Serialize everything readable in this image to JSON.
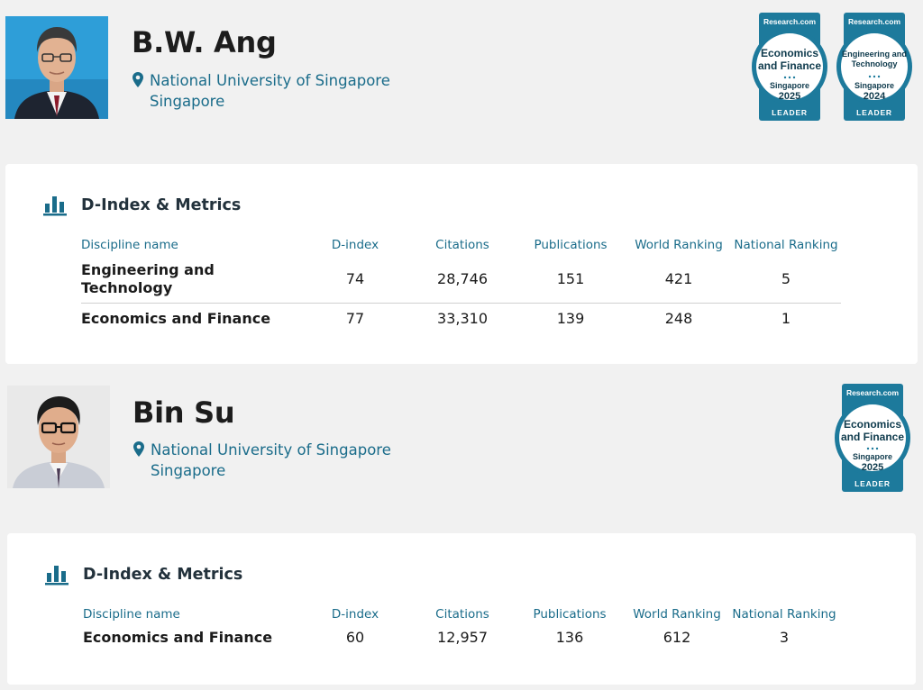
{
  "profiles": [
    {
      "name": "B.W. Ang",
      "university": "National University of Singapore",
      "country": "Singapore",
      "badges": [
        {
          "site": "Research.com",
          "line1": "Economics",
          "line2": "and Finance",
          "region": "Singapore",
          "year": "2025",
          "tag": "LEADER"
        },
        {
          "site": "Research.com",
          "line1": "Engineering and",
          "line2": "Technology",
          "region": "Singapore",
          "year": "2024",
          "tag": "LEADER"
        }
      ],
      "metrics": {
        "title": "D-Index & Metrics",
        "headers": [
          "Discipline name",
          "D-index",
          "Citations",
          "Publications",
          "World Ranking",
          "National Ranking"
        ],
        "rows": [
          {
            "discipline": "Engineering and Technology",
            "dindex": "74",
            "citations": "28,746",
            "publications": "151",
            "world": "421",
            "national": "5"
          },
          {
            "discipline": "Economics and Finance",
            "dindex": "77",
            "citations": "33,310",
            "publications": "139",
            "world": "248",
            "national": "1"
          }
        ]
      }
    },
    {
      "name": "Bin Su",
      "university": "National University of Singapore",
      "country": "Singapore",
      "badges": [
        {
          "site": "Research.com",
          "line1": "Economics",
          "line2": "and Finance",
          "region": "Singapore",
          "year": "2025",
          "tag": "LEADER"
        }
      ],
      "metrics": {
        "title": "D-Index & Metrics",
        "headers": [
          "Discipline name",
          "D-index",
          "Citations",
          "Publications",
          "World Ranking",
          "National Ranking"
        ],
        "rows": [
          {
            "discipline": "Economics and Finance",
            "dindex": "60",
            "citations": "12,957",
            "publications": "136",
            "world": "612",
            "national": "3"
          }
        ]
      }
    }
  ],
  "colors": {
    "accent": "#1a6c8a",
    "badge": "#1d7a9c"
  },
  "icons": {
    "location": "map-pin-icon",
    "metrics": "bar-chart-icon"
  }
}
